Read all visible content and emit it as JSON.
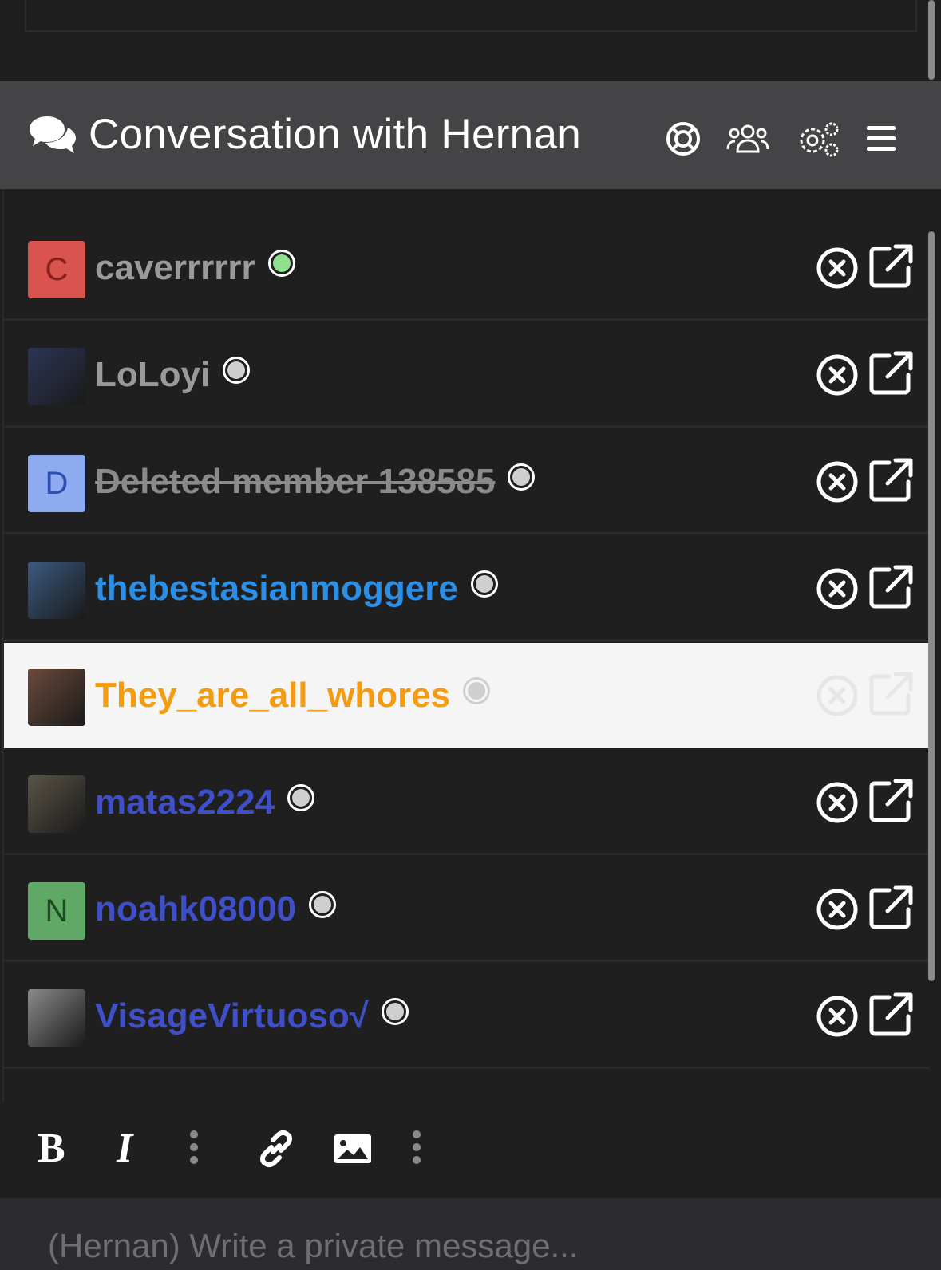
{
  "header": {
    "title": "Conversation with Hernan",
    "icons": [
      "comments-icon",
      "lifebuoy-icon",
      "users-icon",
      "gears-icon",
      "menu-icon"
    ]
  },
  "participants": [
    {
      "name": "caverrrrrr",
      "initial": "C",
      "avatar_color": "#d9534f",
      "initial_color": "#8a1f1c",
      "name_color": "#9a9a9a",
      "status": "online",
      "deleted": false
    },
    {
      "name": "LoLoyi",
      "initial": "",
      "avatar_color": "#2d3557",
      "initial_color": "#ffffff",
      "name_color": "#9a9a9a",
      "status": "offline",
      "deleted": false
    },
    {
      "name": "Deleted member 138585",
      "initial": "D",
      "avatar_color": "#8eaaf0",
      "initial_color": "#2f4fb0",
      "name_color": "#8a8a8a",
      "status": "offline",
      "deleted": true
    },
    {
      "name": "thebestasianmoggere",
      "initial": "",
      "avatar_color": "#3c5a80",
      "initial_color": "#ffffff",
      "name_color": "#2b8fe8",
      "status": "offline",
      "deleted": false
    },
    {
      "name": "They_are_all_whores",
      "initial": "",
      "avatar_color": "#6b4a3a",
      "initial_color": "#ffffff",
      "name_color": "#f39c12",
      "status": "offline",
      "deleted": false
    },
    {
      "name": "matas2224",
      "initial": "",
      "avatar_color": "#5a5448",
      "initial_color": "#ffffff",
      "name_color": "#3f4fc8",
      "status": "offline",
      "deleted": false
    },
    {
      "name": "noahk08000",
      "initial": "N",
      "avatar_color": "#5fa865",
      "initial_color": "#1e4a22",
      "name_color": "#3f4fc8",
      "status": "offline",
      "deleted": false
    },
    {
      "name": "VisageVirtuoso√",
      "initial": "",
      "avatar_color": "#8a8a8a",
      "initial_color": "#ffffff",
      "name_color": "#3f4fc8",
      "status": "offline",
      "deleted": false
    }
  ],
  "highlighted_index": 4,
  "toolbar": {
    "icons": [
      "bold-icon",
      "italic-icon",
      "more-text-icon",
      "link-icon",
      "image-icon",
      "more-insert-icon"
    ]
  },
  "composer": {
    "placeholder": "(Hernan) Write a private message..."
  },
  "colors": {
    "background": "#1f1f20",
    "header": "#444446",
    "online": "#8fe08f",
    "offline": "#cfcfcf"
  }
}
